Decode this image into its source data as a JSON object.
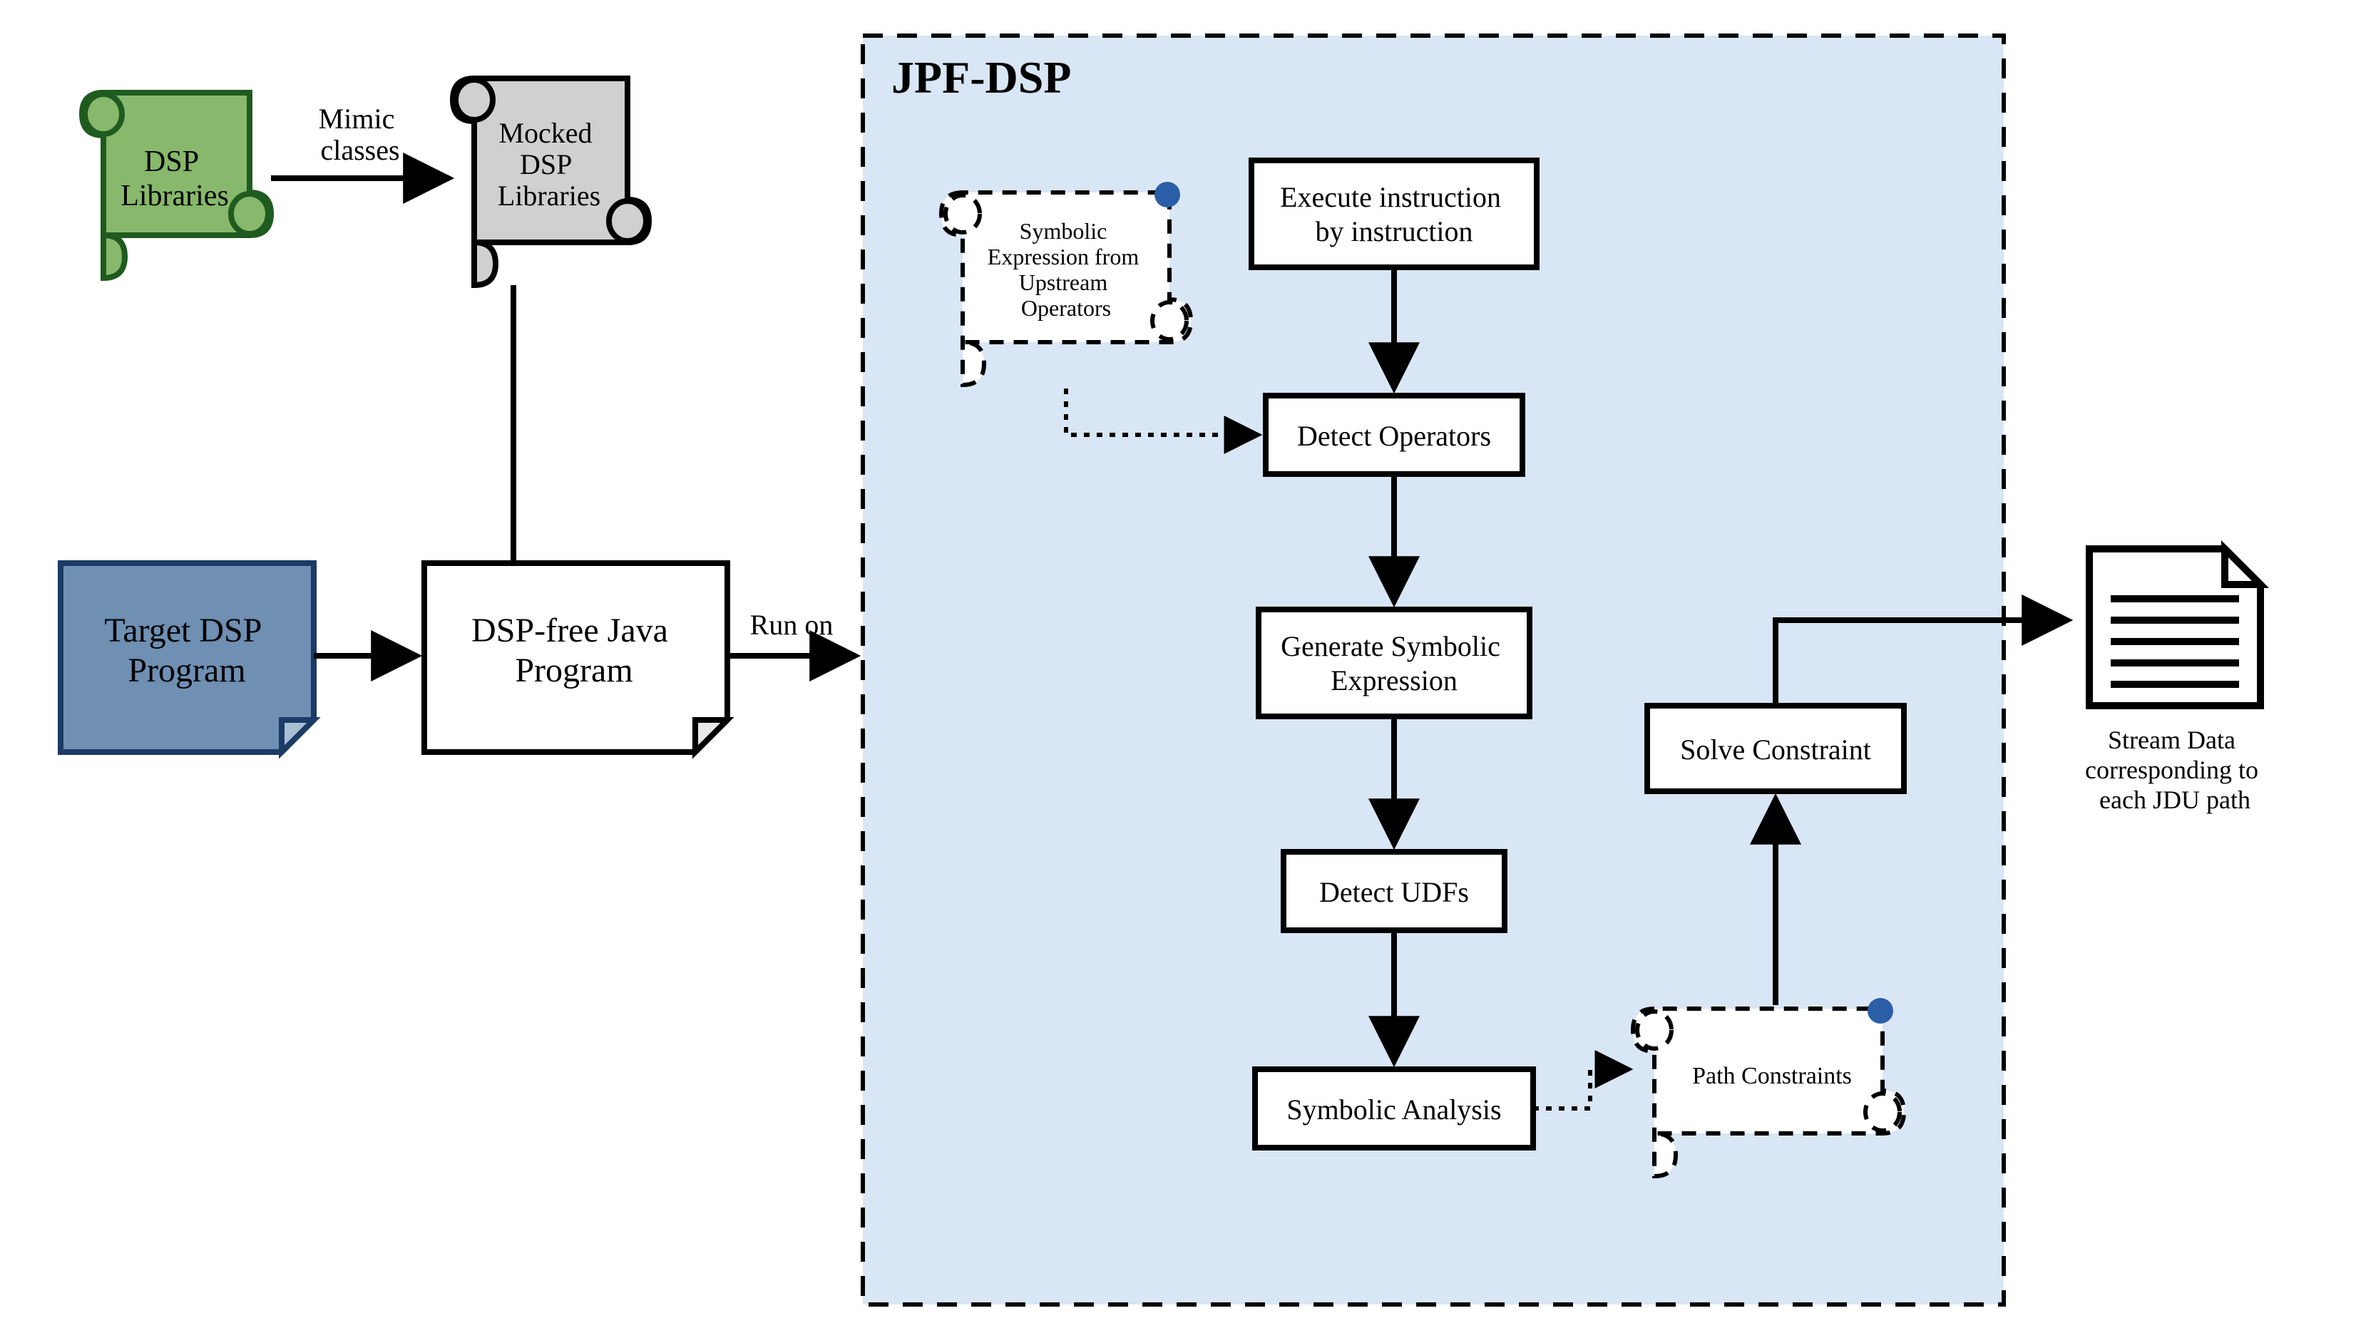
{
  "nodes": {
    "dspLibraries": "DSP\nLibraries",
    "mockedDspLibraries": "Mocked\nDSP\nLibraries",
    "targetDspProgram": "Target DSP\nProgram",
    "dspFreeJava": "DSP-free Java\nProgram",
    "jpfDspTitle": "JPF-DSP",
    "symbolicExprUpstream": "Symbolic\nExpression from\nUpstream\nOperators",
    "executeInstruction": "Execute instruction\nby instruction",
    "detectOperators": "Detect Operators",
    "generateSymbolic": "Generate Symbolic\nExpression",
    "detectUdfs": "Detect UDFs",
    "symbolicAnalysis": "Symbolic Analysis",
    "pathConstraints": "Path Constraints",
    "solveConstraint": "Solve Constraint",
    "outputCaption": "Stream Data\ncorresponding to\neach JDU path"
  },
  "edges": {
    "mimicClasses": "Mimic\nclasses",
    "runOn": "Run on"
  },
  "colors": {
    "dspLibFill": "#87b86b",
    "dspLibStroke": "#1f5b1f",
    "mockedFill": "#d0d0d0",
    "mockedStroke": "#000000",
    "targetFill": "#6f8fb3",
    "targetStroke": "#1b3a66",
    "jpfFill": "#d8e6f5"
  }
}
